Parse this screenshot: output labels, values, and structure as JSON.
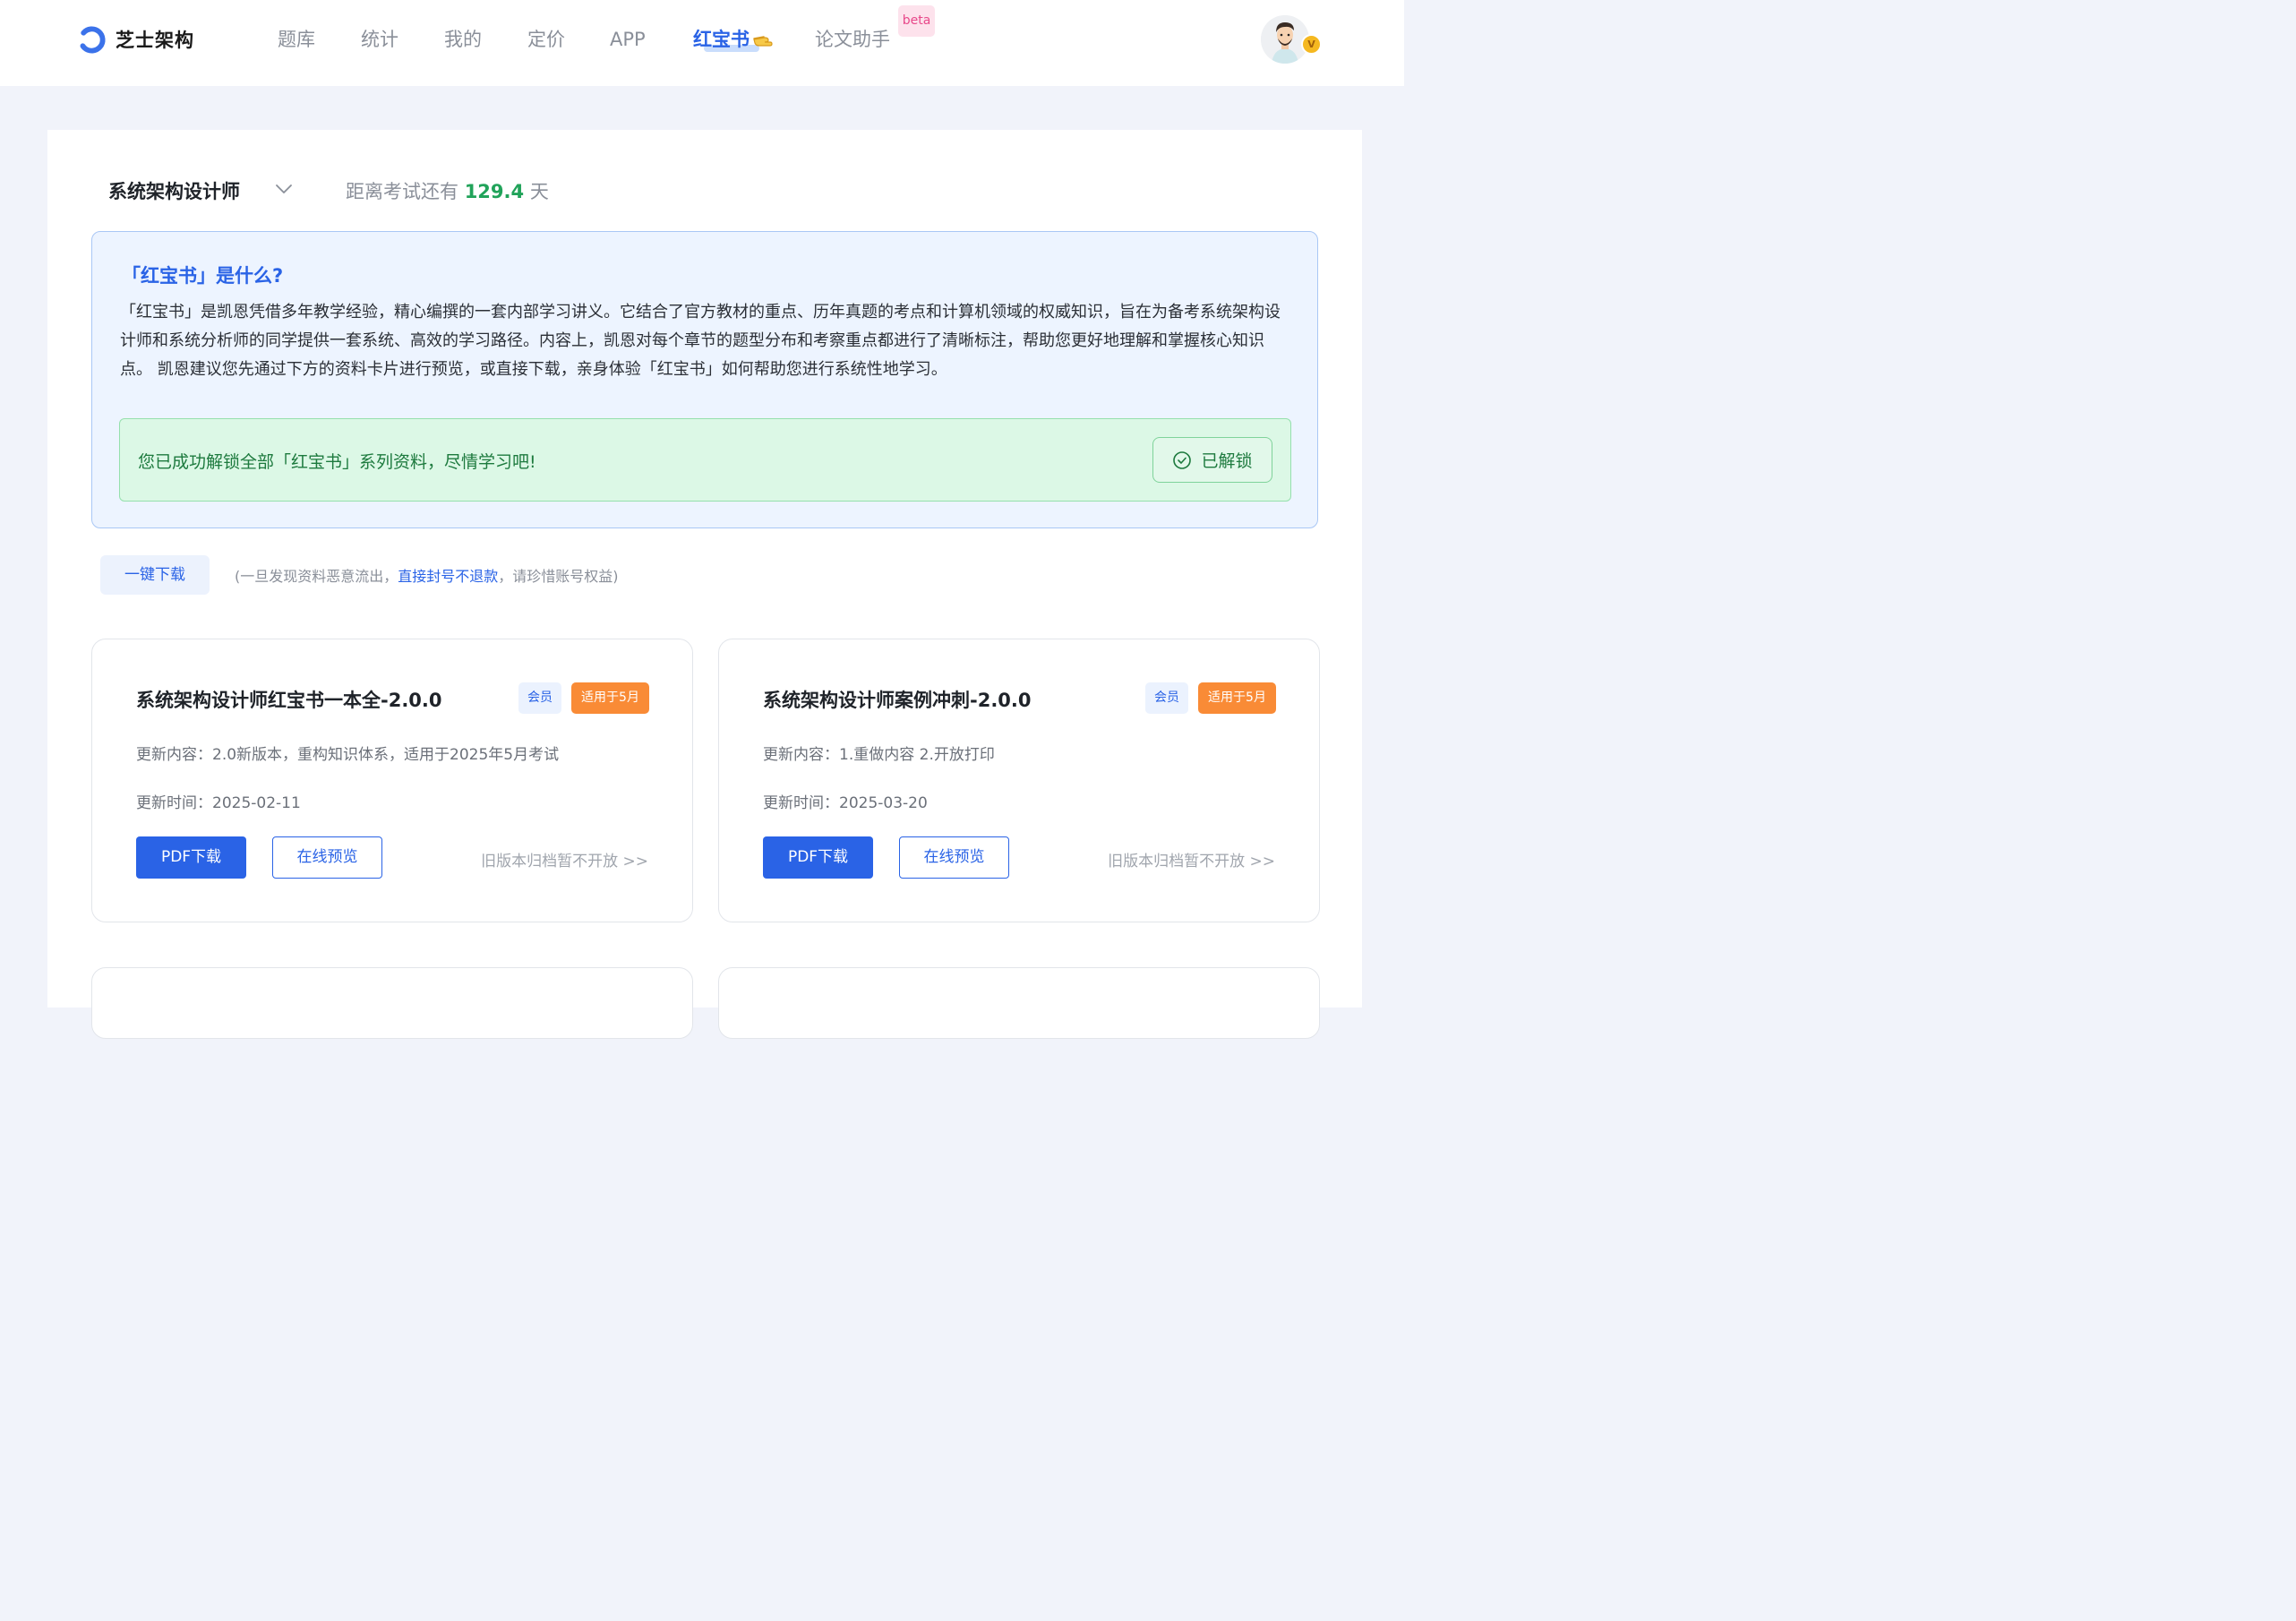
{
  "header": {
    "logo_text": "芝士架构",
    "nav": [
      "题库",
      "统计",
      "我的",
      "定价",
      "APP",
      "红宝书",
      "论文助手"
    ],
    "active_nav": "红宝书",
    "beta_label": "beta",
    "vip_badge": "V"
  },
  "exam": {
    "name": "系统架构设计师",
    "countdown_prefix": "距离考试还有",
    "countdown_value": "129.4",
    "countdown_unit": "天"
  },
  "intro": {
    "title": "「红宝书」是什么?",
    "body": "「红宝书」是凯恩凭借多年教学经验，精心编撰的一套内部学习讲义。它结合了官方教材的重点、历年真题的考点和计算机领域的权威知识，旨在为备考系统架构设计师和系统分析师的同学提供一套系统、高效的学习路径。内容上，凯恩对每个章节的题型分布和考察重点都进行了清晰标注，帮助您更好地理解和掌握核心知识点。 凯恩建议您先通过下方的资料卡片进行预览，或直接下载，亲身体验「红宝书」如何帮助您进行系统性地学习。",
    "unlock_message": "您已成功解锁全部「红宝书」系列资料，尽情学习吧!",
    "unlocked_label": "已解锁"
  },
  "download": {
    "all_label": "一键下载",
    "notice_prefix": "(一旦发现资料恶意流出，",
    "notice_warn": "直接封号不退款",
    "notice_suffix": "，请珍惜账号权益)"
  },
  "cards": [
    {
      "title": "系统架构设计师红宝书一本全-2.0.0",
      "tag_member": "会员",
      "tag_applicable": "适用于5月",
      "update_content": "更新内容：2.0新版本，重构知识体系，适用于2025年5月考试",
      "update_time": "更新时间：2025-02-11",
      "pdf_label": "PDF下载",
      "preview_label": "在线预览",
      "archive_label": "旧版本归档暂不开放 >>"
    },
    {
      "title": "系统架构设计师案例冲刺-2.0.0",
      "tag_member": "会员",
      "tag_applicable": "适用于5月",
      "update_content": "更新内容：1.重做内容 2.开放打印",
      "update_time": "更新时间：2025-03-20",
      "pdf_label": "PDF下载",
      "preview_label": "在线预览",
      "archive_label": "旧版本归档暂不开放 >>"
    }
  ],
  "colors": {
    "brand": "#2a63e6",
    "success": "#21a35a",
    "tag_orange": "#f98b36",
    "beta_pink": "#e8488a"
  }
}
